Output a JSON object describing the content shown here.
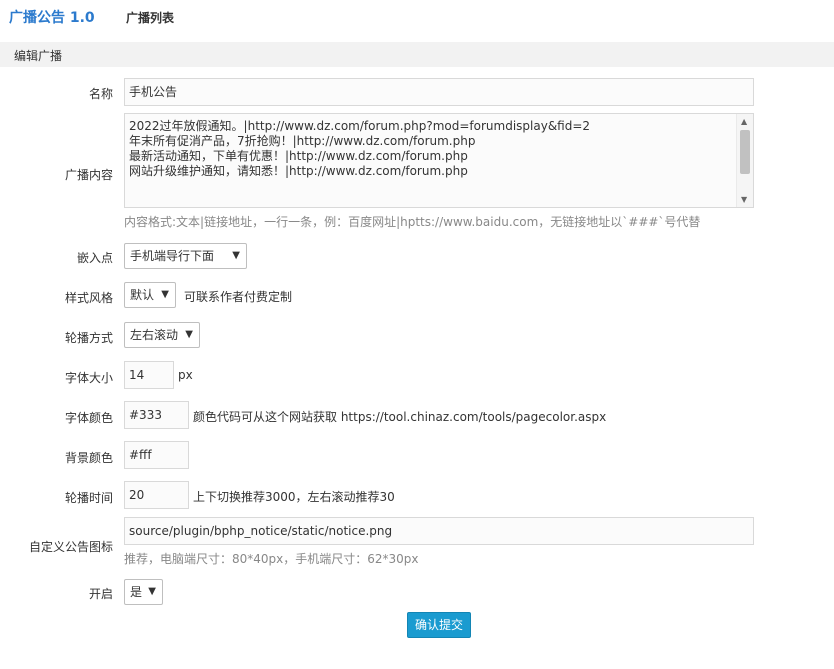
{
  "header": {
    "brand": "广播公告 1.0",
    "tab_list": "广播列表"
  },
  "section": {
    "title": "编辑广播"
  },
  "form": {
    "name": {
      "label": "名称",
      "value": "手机公告"
    },
    "content": {
      "label": "广播内容",
      "lines": [
        "2022过年放假通知。|http://www.dz.com/forum.php?mod=forumdisplay&fid=2",
        "年末所有促消产品，7折抢购！|http://www.dz.com/forum.php",
        "最新活动通知，下单有优惠！|http://www.dz.com/forum.php",
        "网站升级维护通知，请知悉！|http://www.dz.com/forum.php"
      ],
      "hint": "内容格式:文本|链接地址，一行一条，例：百度网址|hptts://www.baidu.com，无链接地址以`###`号代替"
    },
    "embed": {
      "label": "嵌入点",
      "selected": "手机端导行下面"
    },
    "style": {
      "label": "样式风格",
      "selected": "默认",
      "note": "可联系作者付费定制"
    },
    "carousel": {
      "label": "轮播方式",
      "selected": "左右滚动"
    },
    "font_size": {
      "label": "字体大小",
      "value": "14",
      "unit": "px"
    },
    "font_color": {
      "label": "字体颜色",
      "value": "#333",
      "note": "颜色代码可从这个网站获取 https://tool.chinaz.com/tools/pagecolor.aspx"
    },
    "bg_color": {
      "label": "背景颜色",
      "value": "#fff"
    },
    "interval": {
      "label": "轮播时间",
      "value": "20",
      "note": "上下切换推荐3000，左右滚动推荐30"
    },
    "icon": {
      "label": "自定义公告图标",
      "value": "source/plugin/bphp_notice/static/notice.png",
      "hint": "推荐，电脑端尺寸：80*40px，手机端尺寸：62*30px"
    },
    "enabled": {
      "label": "开启",
      "selected": "是"
    },
    "submit_label": "确认提交"
  }
}
